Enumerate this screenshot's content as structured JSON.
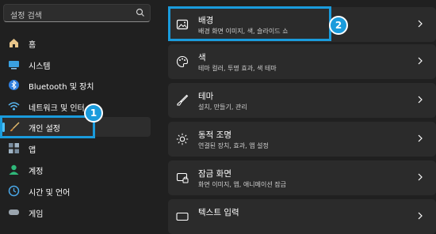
{
  "search": {
    "placeholder": "설정 검색",
    "icon": "search-icon"
  },
  "sidebar": {
    "items": [
      {
        "label": "홈",
        "icon": "home-icon"
      },
      {
        "label": "시스템",
        "icon": "system-icon"
      },
      {
        "label": "Bluetooth 및 장치",
        "icon": "bluetooth-icon"
      },
      {
        "label": "네트워크 및 인터",
        "icon": "wifi-icon"
      },
      {
        "label": "개인 설정",
        "icon": "brush-icon",
        "selected": true
      },
      {
        "label": "앱",
        "icon": "apps-icon"
      },
      {
        "label": "계정",
        "icon": "account-icon"
      },
      {
        "label": "시간 및 언어",
        "icon": "time-language-icon"
      },
      {
        "label": "게임",
        "icon": "gaming-icon"
      }
    ]
  },
  "cards": [
    {
      "title": "배경",
      "subtitle": "배경 화면 이미지, 색, 슬라이드 쇼",
      "icon": "picture-icon"
    },
    {
      "title": "색",
      "subtitle": "테마 컬러, 투명 효과, 색 테마",
      "icon": "palette-icon"
    },
    {
      "title": "테마",
      "subtitle": "설치, 만들기, 관리",
      "icon": "brush-icon"
    },
    {
      "title": "동적 조명",
      "subtitle": "연결된 장치, 효과, 앱 설정",
      "icon": "lighting-icon"
    },
    {
      "title": "잠금 화면",
      "subtitle": "화면 이미지, 앱, 애니메이션 잠금",
      "icon": "lock-screen-icon"
    },
    {
      "title": "텍스트 입력",
      "subtitle": "",
      "icon": "keyboard-icon"
    }
  ],
  "callouts": [
    {
      "number": "1"
    },
    {
      "number": "2"
    }
  ],
  "colors": {
    "background": "#202020",
    "card": "#2b2b2b",
    "accent": "#4cc2ff",
    "callout": "#1a9bdc"
  }
}
